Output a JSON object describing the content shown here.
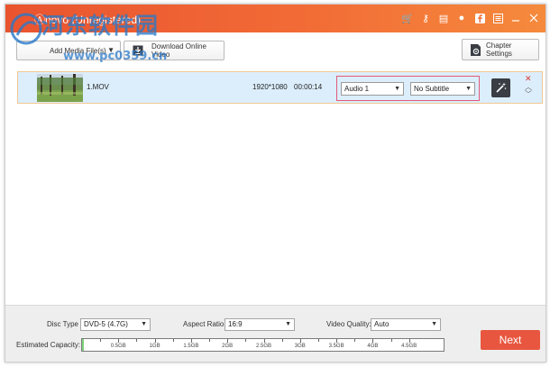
{
  "window": {
    "title": "Ⓐnovo (Unregistered)",
    "accent": "#f26b36"
  },
  "watermark": {
    "cn_text": "河东软件园",
    "url_text": "www.pc0359.cn"
  },
  "titlebar_icons": [
    "cart-icon",
    "key-icon",
    "register-icon",
    "chat-icon",
    "facebook-icon",
    "feedback-icon",
    "minimize-icon",
    "close-icon"
  ],
  "toolbar": {
    "add_label": "Add Media File(s)",
    "download_label": "Download Online Video",
    "chapter_label": "Chapter Settings"
  },
  "files": [
    {
      "name": "1.MOV",
      "resolution": "1920*1080",
      "duration": "00:00:14",
      "audio": "Audio 1",
      "subtitle": "No Subtitle"
    }
  ],
  "bottom": {
    "disc_type_label": "Disc Type",
    "disc_type_value": "DVD-5 (4.7G)",
    "aspect_label": "Aspect Ratio:",
    "aspect_value": "16:9",
    "quality_label": "Video Quality:",
    "quality_value": "Auto",
    "capacity_label": "Estimated Capacity:",
    "capacity_fill": 0.006,
    "capacity_ticks": [
      "0.5GB",
      "1GB",
      "1.5GB",
      "2GB",
      "2.5GB",
      "3GB",
      "3.5GB",
      "4GB",
      "4.5GB"
    ],
    "next_label": "Next",
    "next_color": "#e8563f"
  }
}
